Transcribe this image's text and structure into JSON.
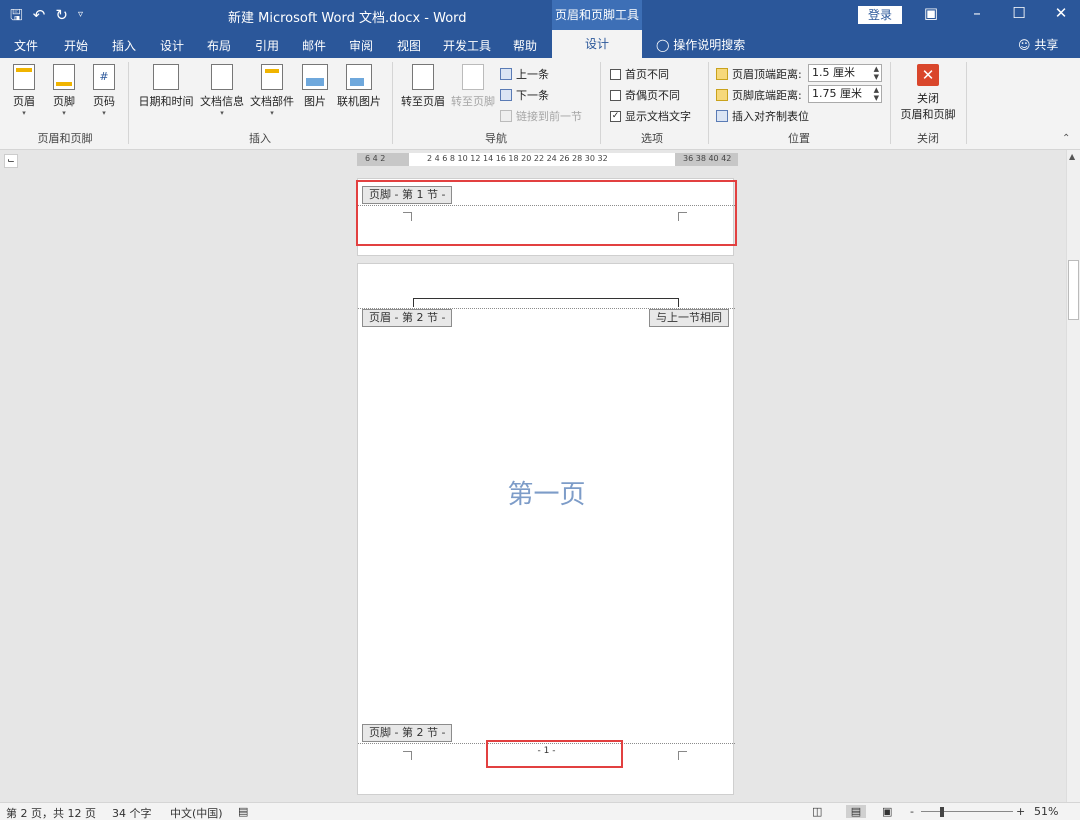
{
  "titlebar": {
    "qat_save_icon": "save-icon",
    "qat_undo_icon": "undo-icon",
    "qat_redo_icon": "redo-icon",
    "qat_customize_icon": "customize-qat-icon",
    "title": "新建 Microsoft Word 文档.docx  -  Word",
    "contextual_tools": "页眉和页脚工具",
    "login": "登录",
    "ribbon_display_icon": "ribbon-display-icon",
    "minimize": "–",
    "maximize": "☐",
    "close": "✕"
  },
  "tabs": {
    "file": "文件",
    "home": "开始",
    "insert": "插入",
    "design": "设计",
    "layout": "布局",
    "references": "引用",
    "mailings": "邮件",
    "review": "审阅",
    "view": "视图",
    "developer": "开发工具",
    "help": "帮助",
    "hf_design": "设计",
    "tell_me": "操作说明搜索",
    "share": "共享"
  },
  "ribbon": {
    "group_hf": {
      "header": "页眉",
      "footer": "页脚",
      "page_number": "页码",
      "label": "页眉和页脚"
    },
    "group_insert": {
      "date_time": "日期和时间",
      "doc_info": "文档信息",
      "quick_parts": "文档部件",
      "pictures": "图片",
      "online_pictures": "联机图片",
      "label": "插入"
    },
    "group_nav": {
      "goto_header": "转至页眉",
      "goto_footer": "转至页脚",
      "previous": "上一条",
      "next": "下一条",
      "link_previous": "链接到前一节",
      "label": "导航"
    },
    "group_options": {
      "different_first": "首页不同",
      "different_odd_even": "奇偶页不同",
      "show_doc_text": "显示文档文字",
      "show_doc_text_checked": true,
      "label": "选项"
    },
    "group_position": {
      "header_from_top": "页眉顶端距离:",
      "header_from_top_value": "1.5 厘米",
      "footer_from_bottom": "页脚底端距离:",
      "footer_from_bottom_value": "1.75 厘米",
      "insert_align_tab": "插入对齐制表位",
      "label": "位置"
    },
    "group_close": {
      "close_line1": "关闭",
      "close_line2": "页眉和页脚",
      "label": "关闭"
    }
  },
  "ruler": {
    "left_numbers": "6  4  2",
    "main_numbers": "2   4   6   8  10  12  14  16  18  20  22  24  26  28  30  32",
    "right_numbers": "36  38  40  42"
  },
  "document": {
    "page1_footer_tag": "页脚 - 第 1 节 -",
    "page2_header_tag": "页眉 - 第 2 节 -",
    "same_as_previous": "与上一节相同",
    "page2_body_text": "第一页",
    "page2_footer_tag": "页脚 - 第 2 节 -",
    "page2_page_number": "- 1 -"
  },
  "statusbar": {
    "page_info": "第 2 页，共 12 页",
    "word_count": "34 个字",
    "language": "中文(中国)",
    "zoom": "51%",
    "zoom_minus": "-",
    "zoom_plus": "+"
  }
}
